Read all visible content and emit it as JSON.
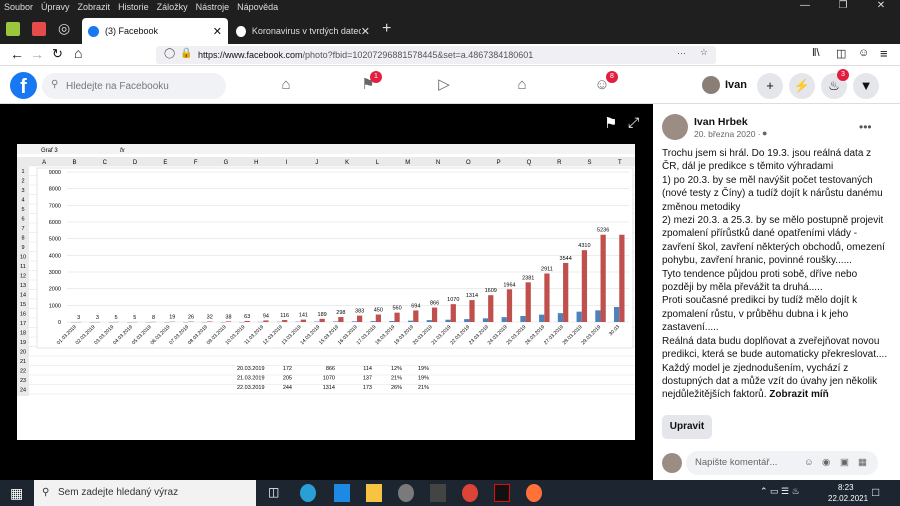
{
  "menubar": {
    "items": [
      "Soubor",
      "Úpravy",
      "Zobrazit",
      "Historie",
      "Záložky",
      "Nástroje",
      "Nápověda"
    ]
  },
  "tabs": [
    {
      "label": "(3) Facebook",
      "active": true
    },
    {
      "label": "Koronavirus v tvrdých datech - ",
      "active": false
    }
  ],
  "address": {
    "host": "https://www.facebook.com",
    "path": "/photo?fbid=10207296881578445&set=a.4867384180601"
  },
  "facebook": {
    "search_placeholder": "Hledejte na Facebooku",
    "user": "Ivan",
    "badge_pages": "1",
    "badge_groups": "8",
    "badge_notifications": "3"
  },
  "post": {
    "author": "Ivan Hrbek",
    "date": "20. března 2020 ·",
    "paragraphs": [
      "Trochu jsem si hrál. Do 19.3. jsou reálná data z ČR, dál je predikce s těmito výhradami",
      "1) po 20.3. by se měl navýšit počet testovaných (nové testy z Číny) a tudíž dojít k nárůstu danému změnou metodiky",
      "2) mezi 20.3. a 25.3. by se mělo postupně projevit zpomalení přírůstků dané opatřeními vlády - zavření škol, zavření některých obchodů, omezení pohybu, zavření hranic, povinné roušky......",
      "Tyto tendence půjdou proti sobě, dříve nebo později by měla převážit ta druhá.....",
      "Proti současné predikci by tudíž mělo dojít k zpomalení růstu, v průběhu dubna i k jeho zastavení.....",
      "Reálná data budu doplňovat a zveřejňovat novou predikci, která se bude automaticky překreslovat....",
      "Každý model je zjednodušením, vychází z dostupných dat a může vzít do úvahy jen několik nejdůležitějších faktorů."
    ],
    "more_label": "Zobrazit míň",
    "button_label": "Upravit",
    "comment_placeholder": "Napište komentář..."
  },
  "spreadsheet": {
    "name_box": "Graf 3",
    "fx": "fx",
    "columns": [
      "A",
      "B",
      "C",
      "D",
      "E",
      "F",
      "G",
      "H",
      "I",
      "J",
      "K",
      "L",
      "M",
      "N",
      "O",
      "P",
      "Q",
      "R",
      "S",
      "T"
    ],
    "rows": [
      "1",
      "2",
      "3",
      "4",
      "5",
      "6",
      "7",
      "8",
      "9",
      "10",
      "11",
      "12",
      "13",
      "14",
      "15",
      "16",
      "17",
      "18",
      "19",
      "20",
      "21",
      "22",
      "23",
      "24"
    ],
    "table": [
      [
        "20.03.2019",
        "172",
        "866",
        "114",
        "12%",
        "19%"
      ],
      [
        "21.03.2019",
        "205",
        "1070",
        "137",
        "21%",
        "19%"
      ],
      [
        "22.03.2019",
        "244",
        "1314",
        "173",
        "26%",
        "21%"
      ]
    ]
  },
  "chart_data": {
    "type": "bar",
    "categories": [
      "01.03.2019",
      "02.03.2019",
      "03.03.2019",
      "04.03.2019",
      "05.03.2019",
      "06.03.2019",
      "07.03.2019",
      "08.03.2019",
      "09.03.2019",
      "10.03.2019",
      "11.03.2019",
      "12.03.2019",
      "13.03.2019",
      "14.03.2019",
      "15.03.2019",
      "16.03.2019",
      "17.03.2019",
      "18.03.2019",
      "19.03.2019",
      "20.03.2019",
      "21.03.2019",
      "22.03.2019",
      "23.03.2019",
      "24.03.2019",
      "25.03.2019",
      "26.03.2019",
      "27.03.2019",
      "28.03.2019",
      "29.03.2019",
      "30.03"
    ],
    "series": [
      {
        "color": "#4f81bd",
        "values": [
          0,
          0,
          0,
          0,
          0,
          0,
          0,
          0,
          0,
          0,
          10,
          15,
          20,
          25,
          30,
          40,
          50,
          60,
          80,
          114,
          137,
          173,
          220,
          290,
          360,
          440,
          530,
          620,
          700,
          900
        ]
      },
      {
        "color": "#c0504d",
        "values": [
          3,
          3,
          5,
          5,
          8,
          19,
          26,
          32,
          38,
          63,
          94,
          116,
          141,
          189,
          298,
          383,
          450,
          560,
          694,
          866,
          1070,
          1314,
          1609,
          1964,
          2381,
          2911,
          3544,
          4310,
          5236,
          5236
        ]
      }
    ],
    "labels": [
      "3",
      "3",
      "5",
      "5",
      "8",
      "19",
      "26",
      "32",
      "38",
      "63",
      "94",
      "116",
      "141",
      "189",
      "298",
      "383",
      "450",
      "560",
      "694",
      "866",
      "1070",
      "1314",
      "1609",
      "1964",
      "2381",
      "2911",
      "3544",
      "4310",
      "5236"
    ],
    "yticks": [
      "9000",
      "8000",
      "7000",
      "6000",
      "5000",
      "4000",
      "3000",
      "2000",
      "1000",
      "0"
    ],
    "ylim": [
      0,
      9000
    ]
  },
  "taskbar": {
    "search_placeholder": "Sem zadejte hledaný výraz",
    "time": "8:23",
    "date": "22.02.2021"
  }
}
